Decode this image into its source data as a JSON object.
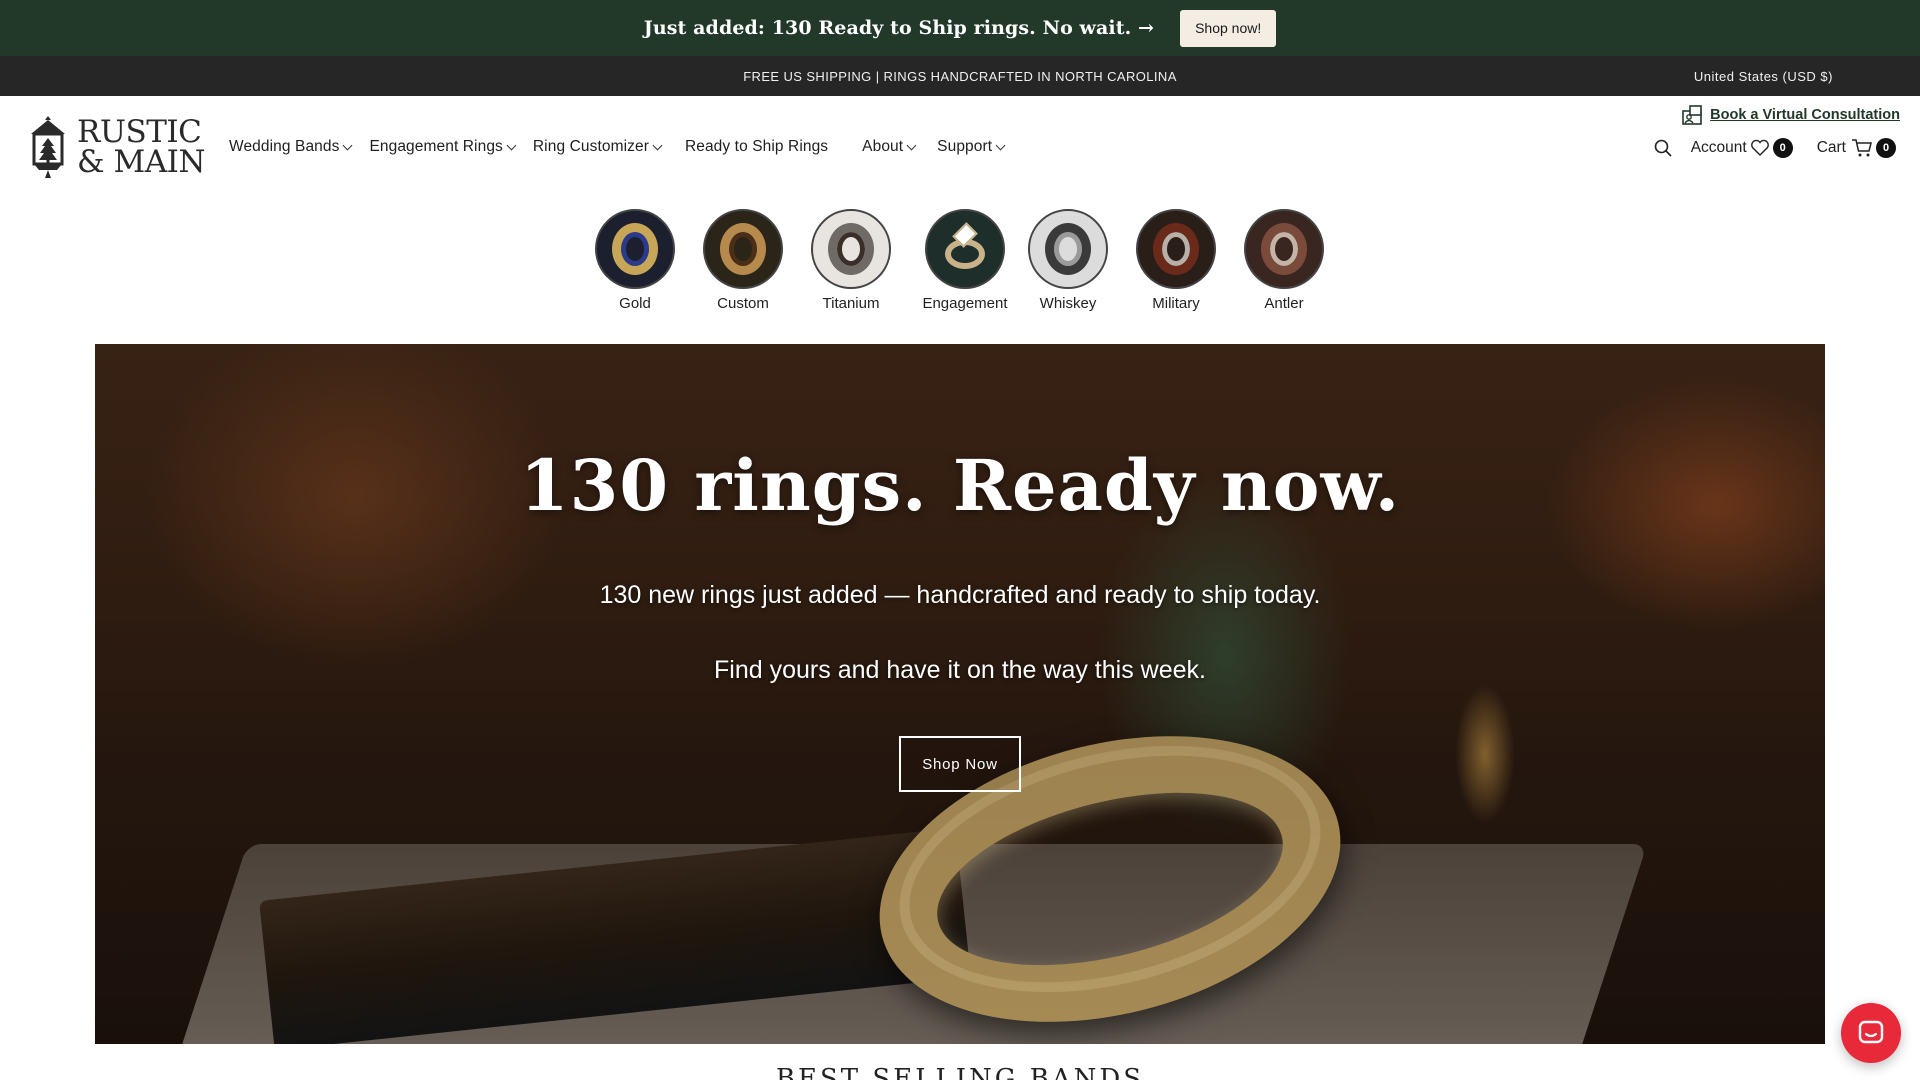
{
  "announcement": {
    "text": "Just added: 130 Ready to Ship rings. No wait. →",
    "button_label": "Shop now!"
  },
  "infobar": {
    "text": "FREE US SHIPPING | RINGS HANDCRAFTED IN NORTH CAROLINA",
    "currency": "United States (USD $)"
  },
  "header": {
    "logo_line1": "RUSTIC",
    "logo_line2": "& MAIN",
    "logo_icon": "lantern-tree-icon",
    "consultation_label": "Book a Virtual Consultation",
    "consultation_icon": "video-call-icon",
    "nav": [
      {
        "label": "Wedding Bands",
        "has_dropdown": true
      },
      {
        "label": "Engagement Rings",
        "has_dropdown": true
      },
      {
        "label": "Ring Customizer",
        "has_dropdown": true
      },
      {
        "label": "Ready to Ship Rings",
        "has_dropdown": false
      },
      {
        "label": "About",
        "has_dropdown": true
      },
      {
        "label": "Support",
        "has_dropdown": true
      }
    ],
    "search_icon": "search-icon",
    "account_label": "Account",
    "wishlist_count": "0",
    "cart_label": "Cart",
    "cart_count": "0"
  },
  "categories": [
    {
      "label": "Gold",
      "colors": [
        "#1c1f2e",
        "#c8a657",
        "#2b3a8a"
      ]
    },
    {
      "label": "Custom",
      "colors": [
        "#2b2418",
        "#b58a4c",
        "#4a2e18"
      ]
    },
    {
      "label": "Titanium",
      "colors": [
        "#e8e4e0",
        "#6f6a66",
        "#3a2e28"
      ]
    },
    {
      "label": "Engagement",
      "colors": [
        "#1e2e2a",
        "#c9b28a",
        "#ffffff"
      ]
    },
    {
      "label": "Whiskey",
      "colors": [
        "#dcdcdc",
        "#3a3a3a",
        "#9a9a9a"
      ]
    },
    {
      "label": "Military",
      "colors": [
        "#2a1e18",
        "#6a2a1a",
        "#b8b0a8"
      ]
    },
    {
      "label": "Antler",
      "colors": [
        "#3a2620",
        "#7a4a3a",
        "#c4b4a8"
      ]
    }
  ],
  "hero": {
    "title": "130 rings. Ready now.",
    "subtitle_1": "130 new rings just added — handcrafted and ready to ship today.",
    "subtitle_2": "Find yours and have it on the way this week.",
    "button_label": "Shop Now"
  },
  "section_heading": "BEST SELLING BANDS",
  "chat": {
    "icon": "chat-bubble-icon"
  },
  "colors": {
    "announcement_bg": "#22392a",
    "infobar_bg": "#262626",
    "chat_accent": "#e8293a"
  }
}
